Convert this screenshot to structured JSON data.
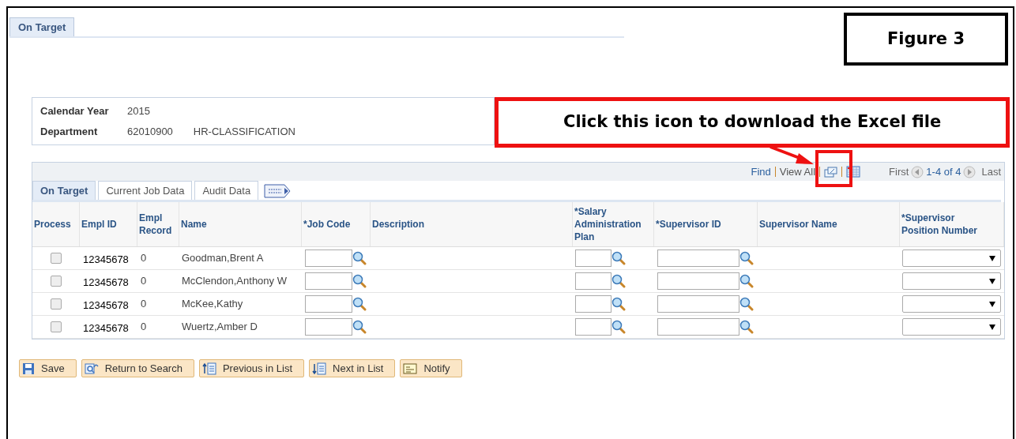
{
  "page_tab": {
    "label": "On Target",
    "selected": true
  },
  "figure_label": "Figure 3",
  "callout": "Click this icon to download the Excel file",
  "header": [
    {
      "label": "Calendar Year",
      "values": [
        "2015"
      ]
    },
    {
      "label": "Department",
      "values": [
        "62010900",
        "HR-CLASSIFICATION"
      ]
    }
  ],
  "grid_toolbar": {
    "find": "Find",
    "view_all": "View All",
    "first": "First",
    "range": "1-4 of 4",
    "last": "Last"
  },
  "grid_tabs": [
    {
      "label": "On Target",
      "selected": true
    },
    {
      "label": "Current Job Data",
      "selected": false
    },
    {
      "label": "Audit Data",
      "selected": false
    }
  ],
  "columns": [
    "Process",
    "Empl ID",
    "Empl Record",
    "Name",
    "*Job Code",
    "Description",
    "*Salary Administration Plan",
    "*Supervisor ID",
    "Supervisor Name",
    "*Supervisor Position Number"
  ],
  "rows": [
    {
      "checked": false,
      "empl_id": "12345678",
      "empl_record": "0",
      "name": "Goodman,Brent A"
    },
    {
      "checked": false,
      "empl_id": "12345678",
      "empl_record": "0",
      "name": "McClendon,Anthony W"
    },
    {
      "checked": false,
      "empl_id": "12345678",
      "empl_record": "0",
      "name": "McKee,Kathy"
    },
    {
      "checked": false,
      "empl_id": "12345678",
      "empl_record": "0",
      "name": "Wuertz,Amber D"
    }
  ],
  "buttons": [
    {
      "kind": "save",
      "label": "Save"
    },
    {
      "kind": "return",
      "label": "Return to Search"
    },
    {
      "kind": "previous",
      "label": "Previous in List"
    },
    {
      "kind": "next",
      "label": "Next in List"
    },
    {
      "kind": "notify",
      "label": "Notify"
    }
  ]
}
